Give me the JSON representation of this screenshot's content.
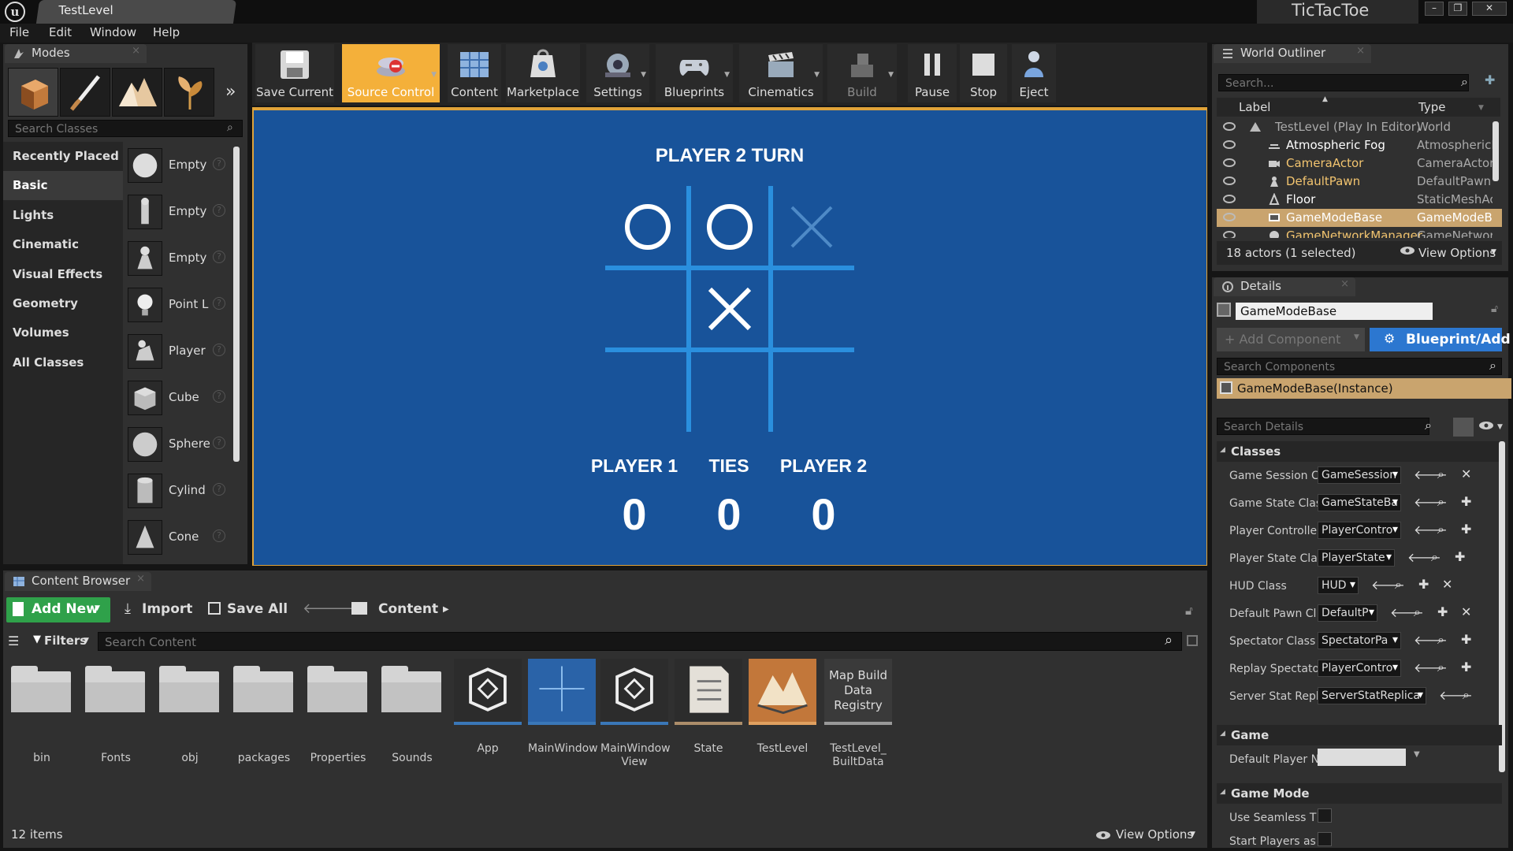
{
  "window": {
    "doc_tab": "TestLevel",
    "project": "TicTacToe"
  },
  "menu": [
    "File",
    "Edit",
    "Window",
    "Help"
  ],
  "modes": {
    "tab": "Modes",
    "search_placeholder": "Search Classes",
    "categories": [
      "Recently Placed",
      "Basic",
      "Lights",
      "Cinematic",
      "Visual Effects",
      "Geometry",
      "Volumes",
      "All Classes"
    ],
    "items": [
      "Empty",
      "Empty",
      "Empty",
      "Point L",
      "Player",
      "Cube",
      "Sphere",
      "Cylind",
      "Cone"
    ]
  },
  "toolbar": [
    "Save Current",
    "Source Control",
    "Content",
    "Marketplace",
    "Settings",
    "Blueprints",
    "Cinematics",
    "Build",
    "Pause",
    "Stop",
    "Eject"
  ],
  "game": {
    "turn": "PLAYER 2 TURN",
    "board": [
      "O",
      "O",
      "X",
      "",
      "X",
      "",
      "",
      "",
      ""
    ],
    "score_labels": [
      "PLAYER 1",
      "TIES",
      "PLAYER 2"
    ],
    "scores": [
      "0",
      "0",
      "0"
    ],
    "accent": "#2a8fde",
    "bg": "#18539a"
  },
  "outliner": {
    "tab": "World Outliner",
    "search_placeholder": "Search...",
    "col_label": "Label",
    "col_type": "Type",
    "rows": [
      {
        "label": "TestLevel (Play In Editor)",
        "type": "World"
      },
      {
        "label": "Atmospheric Fog",
        "type": "AtmosphericF"
      },
      {
        "label": "CameraActor",
        "type": "CameraActor"
      },
      {
        "label": "DefaultPawn",
        "type": "DefaultPawn"
      },
      {
        "label": "Floor",
        "type": "StaticMeshAc"
      },
      {
        "label": "GameModeBase",
        "type": "GameModeB"
      },
      {
        "label": "GameNetworkManager",
        "type": "GameNetwork"
      }
    ],
    "status": "18 actors (1 selected)",
    "view_options": "View Options"
  },
  "details": {
    "tab": "Details",
    "name": "GameModeBase",
    "add_component": "+ Add Component",
    "blueprint_add": "Blueprint/Add",
    "search_components": "Search Components",
    "instance": "GameModeBase(Instance)",
    "search_details": "Search Details",
    "classes_header": "Classes",
    "class_rows": [
      {
        "label": "Game Session C",
        "value": "GameSession"
      },
      {
        "label": "Game State Clas",
        "value": "GameStateBa"
      },
      {
        "label": "Player Controlle",
        "value": "PlayerContro"
      },
      {
        "label": "Player State Cla",
        "value": "PlayerState"
      },
      {
        "label": "HUD Class",
        "value": "HUD"
      },
      {
        "label": "Default Pawn Cl",
        "value": "DefaultP"
      },
      {
        "label": "Spectator Class",
        "value": "SpectatorPa"
      },
      {
        "label": "Replay Spectato",
        "value": "PlayerContro"
      },
      {
        "label": "Server Stat Repl",
        "value": "ServerStatReplica"
      }
    ],
    "game_header": "Game",
    "default_player": "Default Player N",
    "gamemode_header": "Game Mode",
    "use_seamless": "Use Seamless T",
    "start_players": "Start Players as"
  },
  "content_browser": {
    "tab": "Content Browser",
    "add_new": "Add New",
    "import": "Import",
    "save_all": "Save All",
    "path": "Content",
    "filters": "Filters",
    "search_placeholder": "Search Content",
    "assets": [
      {
        "name": "bin",
        "kind": "folder"
      },
      {
        "name": "Fonts",
        "kind": "folder"
      },
      {
        "name": "obj",
        "kind": "folder"
      },
      {
        "name": "packages",
        "kind": "folder"
      },
      {
        "name": "Properties",
        "kind": "folder"
      },
      {
        "name": "Sounds",
        "kind": "folder"
      },
      {
        "name": "App",
        "kind": "blueprint"
      },
      {
        "name": "MainWindow",
        "kind": "widget"
      },
      {
        "name": "MainWindow View",
        "kind": "blueprint"
      },
      {
        "name": "State",
        "kind": "enum"
      },
      {
        "name": "TestLevel",
        "kind": "level"
      },
      {
        "name": "TestLevel_ BuiltData",
        "kind": "data"
      }
    ],
    "map_build_label": "Map Build Data Registry",
    "count": "12 items",
    "view_options": "View Options"
  }
}
